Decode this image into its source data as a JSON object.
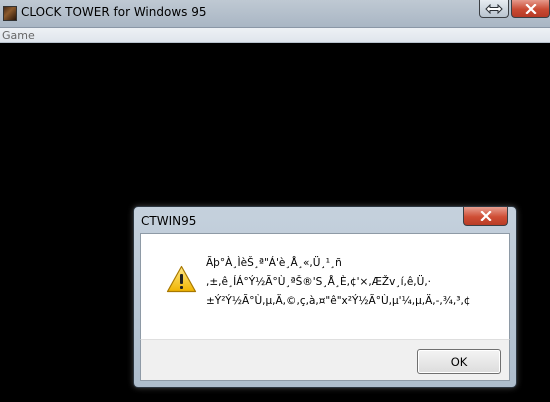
{
  "window": {
    "title": "CLOCK TOWER for Windows 95",
    "icon": "clock-tower-app-icon",
    "restore_icon": "restore-arrows-icon",
    "close_icon": "close-icon"
  },
  "menubar": {
    "items": [
      {
        "label": "Game"
      }
    ]
  },
  "dialog": {
    "title": "CTWIN95",
    "close_icon": "close-icon",
    "icon": "warning-icon",
    "message_lines": [
      "Ãþ°À¸ÌèŠ¸ª\"Á'è¸Å¸«,Ü¸¹¸ñ",
      ",±,ê¸ÍÁ°Ý½Ã°Ù¸ªŠ®'S¸Å¸È,¢'×,ÆŽv¸í,ê,Ü,·",
      "±Ý²Ý½Ã°Ù,µ,Ä,©,ç,à,¤\"ê\"x²Ý½Ã°Ù,µ'¼,µ,Ä,-,¾,³,¢"
    ],
    "ok_label": "OK"
  },
  "colors": {
    "desktop": "#000000",
    "dialog_close": "#c94a33",
    "warning": "#f2c200"
  }
}
